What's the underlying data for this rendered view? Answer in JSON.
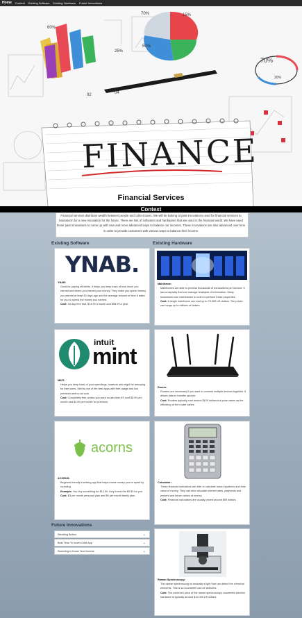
{
  "nav": {
    "home": "Home",
    "items": [
      "Context",
      "Existing Software",
      "Existing Hardware",
      "Future Innovations"
    ]
  },
  "hero": {
    "headline": "FINANCE",
    "caption": "Financial Services",
    "chart_labels": [
      "70%",
      "15%",
      "50%",
      "60%",
      "25%",
      "70%",
      "20%",
      "02",
      "04"
    ]
  },
  "context": {
    "title": "Context",
    "lines": [
      "Financial services distribute wealth between people and collect taxes. We will be looking at past innovations used for financial services to",
      "brainstorm for a new innovation for the future. There are lots of softwares and hardwares that are used in the financial world. We have used",
      "these past innovations to come up with new and more advanced ways to balance our incomes. These innovations are also advanced over time",
      "in order to provide customers with various ways to balance their income."
    ]
  },
  "software": {
    "title": "Existing Software",
    "items": [
      {
        "logo": "YNAB.",
        "name": "YNAB:",
        "desc": "Good for paying off debts. It helps you keep track of how much you earned and where you earned your money. They make you spend money you earned at least 30 days ago and the average amount of time it takes for you to spend the money you earned.",
        "cost_label": "Cost:",
        "cost": "34 day free trial, $14.99 a month and $98.99 a year."
      },
      {
        "logo_top": "intuit",
        "logo": "mint",
        "name": "MINT:",
        "desc": "Helps you keep track of your spendings, however ads might be annoying for free users. Mint is one of the best apps with free usage and low premium and no ad cost.",
        "cost_label": "Cost:",
        "cost": "Completely free unless you want no ads then it'll cost $5.99 per month and $4.99 per month for premium."
      },
      {
        "logo": "acorns",
        "name": "ACORNS:",
        "desc": "Beginner friendly investing app that helps invest money you've spent by rounding.",
        "example_label": "Example:",
        "example": "You buy something for $12.50, they invest the $0.50 for you.",
        "cost_label": "Cost:",
        "cost": "$3 per month personal plan and $5 per month family plan."
      }
    ]
  },
  "hardware": {
    "title": "Existing Hardware",
    "items": [
      {
        "name": "Mainframe:",
        "desc": "Mainframes are able to process thousands of transactions per second. It has a capacity that can manage terabytes of information. Many businesses use mainframes in order to perform these properties.",
        "cost_label": "Cost:",
        "cost": "A single mainframe can cost up to 75,000 US dollars. The prices can range up to millions of dollars."
      },
      {
        "name": "Router:",
        "desc": "Routers are necessary if you want to connect multiple devices together. It allows data to transfer quicker.",
        "cost_label": "Cost:",
        "cost": "Routers typically cost around $100 dollars but price varies as the efficiency of the router varies."
      },
      {
        "name": "Calculator:",
        "desc": "These financial calculators are able to calculate basic equations and time value of money. They can also calculate interest rates, payments and present and future values of money.",
        "cost_label": "Cost:",
        "cost": "Financial calculators are usually priced around $50 dollars."
      },
      {
        "name": "Raman Spectroscopy:",
        "desc": "The raman spectroscopy is basically a light that can detect the chemical elements. This is so counterfeit can be detected.",
        "cost_label": "Cost:",
        "cost": "The minimum price of the raman spectroscopy counterfeit electron hardware is typically around $12,000 US dollars."
      }
    ]
  },
  "future": {
    "title": "Future Innovations",
    "items": [
      "Wedding Button",
      "Best Time To Invest Orbit App",
      "Scanning to Know Your Income"
    ]
  },
  "colors": {
    "ynab_navy": "#1e2b4a",
    "ynab_dot": "#6aa7e6",
    "mint_green": "#1f8a6e",
    "acorns_green": "#7cbf4a",
    "nav_bg": "#2b2b2b"
  }
}
